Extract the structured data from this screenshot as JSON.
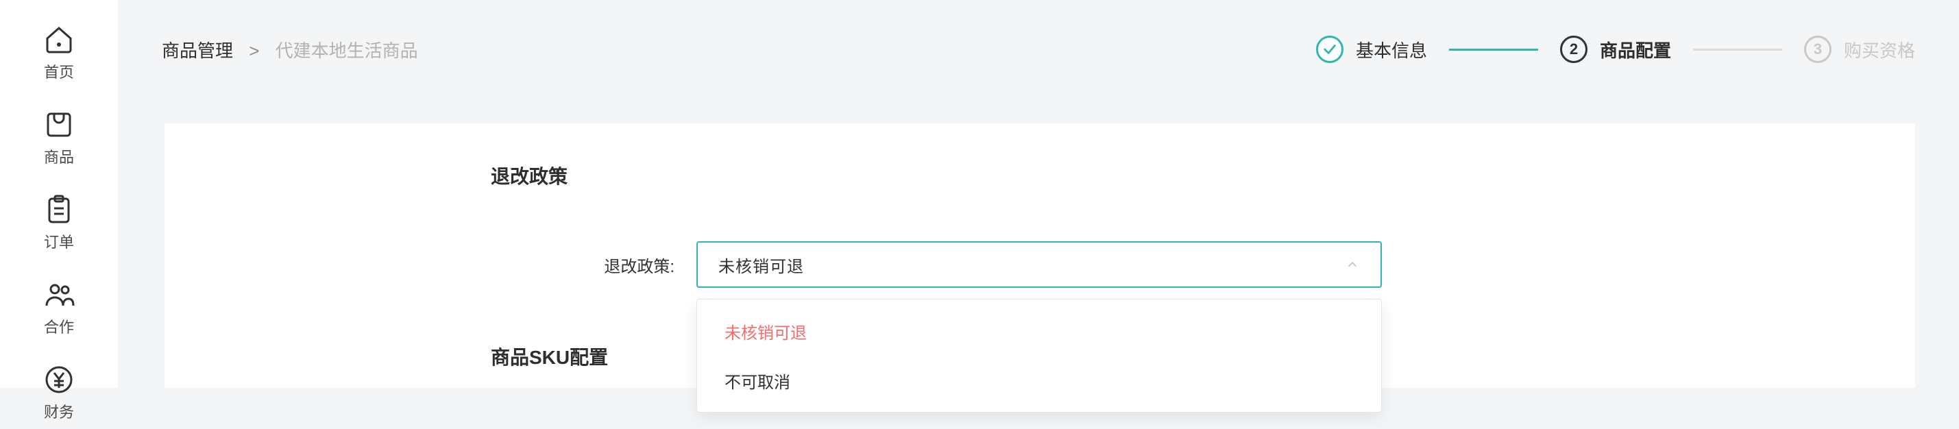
{
  "sidebar": {
    "items": [
      {
        "label": "首页",
        "icon": "home-icon"
      },
      {
        "label": "商品",
        "icon": "bag-icon"
      },
      {
        "label": "订单",
        "icon": "clipboard-icon"
      },
      {
        "label": "合作",
        "icon": "partners-icon"
      },
      {
        "label": "财务",
        "icon": "yen-icon"
      }
    ]
  },
  "breadcrumb": {
    "parent": "商品管理",
    "sep": ">",
    "current": "代建本地生活商品"
  },
  "steps": [
    {
      "title": "基本信息",
      "state": "done"
    },
    {
      "title": "商品配置",
      "state": "active",
      "num": "2"
    },
    {
      "title": "购买资格",
      "state": "todo",
      "num": "3"
    }
  ],
  "policy": {
    "section_title": "退改政策",
    "row_label": "退改政策:",
    "selected_value": "未核销可退",
    "options": [
      {
        "text": "未核销可退",
        "selected": true
      },
      {
        "text": "不可取消",
        "selected": false
      }
    ]
  },
  "sku": {
    "section_title": "商品SKU配置"
  }
}
